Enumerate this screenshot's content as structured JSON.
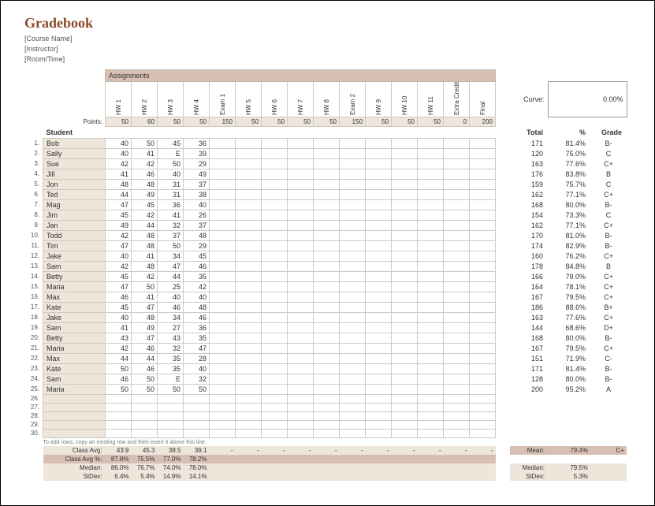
{
  "title": "Gradebook",
  "meta": {
    "course": "[Course Name]",
    "instructor": "[Instructor]",
    "room": "[Room/Time]"
  },
  "assignments_label": "Assignments",
  "points_label": "Points:",
  "student_label": "Student",
  "curve_label": "Curve:",
  "curve_value": "0.00%",
  "totals_header": {
    "total": "Total",
    "pct": "%",
    "grade": "Grade"
  },
  "columns": [
    {
      "name": "HW 1",
      "pts": 50
    },
    {
      "name": "HW 2",
      "pts": 60
    },
    {
      "name": "HW 3",
      "pts": 50
    },
    {
      "name": "HW 4",
      "pts": 50
    },
    {
      "name": "Exam 1",
      "pts": 150
    },
    {
      "name": "HW 5",
      "pts": 50
    },
    {
      "name": "HW 6",
      "pts": 50
    },
    {
      "name": "HW 7",
      "pts": 50
    },
    {
      "name": "HW 8",
      "pts": 50
    },
    {
      "name": "Exam 2",
      "pts": 150
    },
    {
      "name": "HW 9",
      "pts": 50
    },
    {
      "name": "HW 10",
      "pts": 50
    },
    {
      "name": "HW 11",
      "pts": 50
    },
    {
      "name": "Extra Credit",
      "pts": 0
    },
    {
      "name": "Final",
      "pts": 200
    }
  ],
  "students": [
    {
      "name": "Bob",
      "scores": [
        40,
        50,
        45,
        36
      ],
      "total": 171,
      "pct": "81.4%",
      "grade": "B-"
    },
    {
      "name": "Sally",
      "scores": [
        40,
        41,
        "E",
        39
      ],
      "total": 120,
      "pct": "75.0%",
      "grade": "C"
    },
    {
      "name": "Sue",
      "scores": [
        42,
        42,
        50,
        29
      ],
      "total": 163,
      "pct": "77.6%",
      "grade": "C+"
    },
    {
      "name": "Jill",
      "scores": [
        41,
        46,
        40,
        49
      ],
      "total": 176,
      "pct": "83.8%",
      "grade": "B"
    },
    {
      "name": "Jon",
      "scores": [
        48,
        48,
        31,
        37
      ],
      "total": 159,
      "pct": "75.7%",
      "grade": "C"
    },
    {
      "name": "Ted",
      "scores": [
        44,
        49,
        31,
        38
      ],
      "total": 162,
      "pct": "77.1%",
      "grade": "C+"
    },
    {
      "name": "Mag",
      "scores": [
        47,
        45,
        36,
        40
      ],
      "total": 168,
      "pct": "80.0%",
      "grade": "B-"
    },
    {
      "name": "Jim",
      "scores": [
        45,
        42,
        41,
        26
      ],
      "total": 154,
      "pct": "73.3%",
      "grade": "C"
    },
    {
      "name": "Jan",
      "scores": [
        49,
        44,
        32,
        37
      ],
      "total": 162,
      "pct": "77.1%",
      "grade": "C+"
    },
    {
      "name": "Todd",
      "scores": [
        42,
        48,
        37,
        48
      ],
      "total": 170,
      "pct": "81.0%",
      "grade": "B-"
    },
    {
      "name": "Tim",
      "scores": [
        47,
        48,
        50,
        29
      ],
      "total": 174,
      "pct": "82.9%",
      "grade": "B-"
    },
    {
      "name": "Jake",
      "scores": [
        40,
        41,
        34,
        45
      ],
      "total": 160,
      "pct": "76.2%",
      "grade": "C+"
    },
    {
      "name": "Sam",
      "scores": [
        42,
        48,
        47,
        46
      ],
      "total": 178,
      "pct": "84.8%",
      "grade": "B"
    },
    {
      "name": "Betty",
      "scores": [
        45,
        42,
        44,
        35
      ],
      "total": 166,
      "pct": "79.0%",
      "grade": "C+"
    },
    {
      "name": "Maria",
      "scores": [
        47,
        50,
        25,
        42
      ],
      "total": 164,
      "pct": "78.1%",
      "grade": "C+"
    },
    {
      "name": "Max",
      "scores": [
        46,
        41,
        40,
        40
      ],
      "total": 167,
      "pct": "79.5%",
      "grade": "C+"
    },
    {
      "name": "Kate",
      "scores": [
        45,
        47,
        46,
        48
      ],
      "total": 186,
      "pct": "88.6%",
      "grade": "B+"
    },
    {
      "name": "Jake",
      "scores": [
        40,
        48,
        34,
        46
      ],
      "total": 163,
      "pct": "77.6%",
      "grade": "C+"
    },
    {
      "name": "Sam",
      "scores": [
        41,
        49,
        27,
        36
      ],
      "total": 144,
      "pct": "68.6%",
      "grade": "D+"
    },
    {
      "name": "Betty",
      "scores": [
        43,
        47,
        43,
        35
      ],
      "total": 168,
      "pct": "80.0%",
      "grade": "B-"
    },
    {
      "name": "Maria",
      "scores": [
        42,
        46,
        32,
        47
      ],
      "total": 167,
      "pct": "79.5%",
      "grade": "C+"
    },
    {
      "name": "Max",
      "scores": [
        44,
        44,
        35,
        28
      ],
      "total": 151,
      "pct": "71.9%",
      "grade": "C-"
    },
    {
      "name": "Kate",
      "scores": [
        50,
        46,
        35,
        40
      ],
      "total": 171,
      "pct": "81.4%",
      "grade": "B-"
    },
    {
      "name": "Sam",
      "scores": [
        46,
        50,
        "E",
        32
      ],
      "total": 128,
      "pct": "80.0%",
      "grade": "B-"
    },
    {
      "name": "Maria",
      "scores": [
        50,
        50,
        50,
        50
      ],
      "total": 200,
      "pct": "95.2%",
      "grade": "A"
    }
  ],
  "empty_rows": [
    26,
    27,
    28,
    29,
    30
  ],
  "footnote": "To add rows, copy an existing row and then insert it above this line.",
  "stats": {
    "class_avg_label": "Class Avg:",
    "class_avg": [
      "43.9",
      "45.3",
      "38.5",
      "39.1"
    ],
    "class_avg_trail": [
      "-",
      "-",
      "-",
      "-",
      "-",
      "-",
      "-",
      "-",
      "-",
      "-",
      "-"
    ],
    "class_avg_pct_label": "Class Avg %:",
    "class_avg_pct": [
      "87.8%",
      "75.5%",
      "77.0%",
      "78.2%"
    ],
    "median_label": "Median:",
    "median": [
      "86.0%",
      "76.7%",
      "74.0%",
      "78.0%"
    ],
    "stdev_label": "StDev:",
    "stdev": [
      "6.4%",
      "5.4%",
      "14.9%",
      "14.1%"
    ],
    "mean_label": "Mean:",
    "mean_val": "79.4%",
    "mean_grade": "C+",
    "median2_label": "Median:",
    "median2_val": "79.5%",
    "stdev2_label": "StDev:",
    "stdev2_val": "5.3%"
  }
}
